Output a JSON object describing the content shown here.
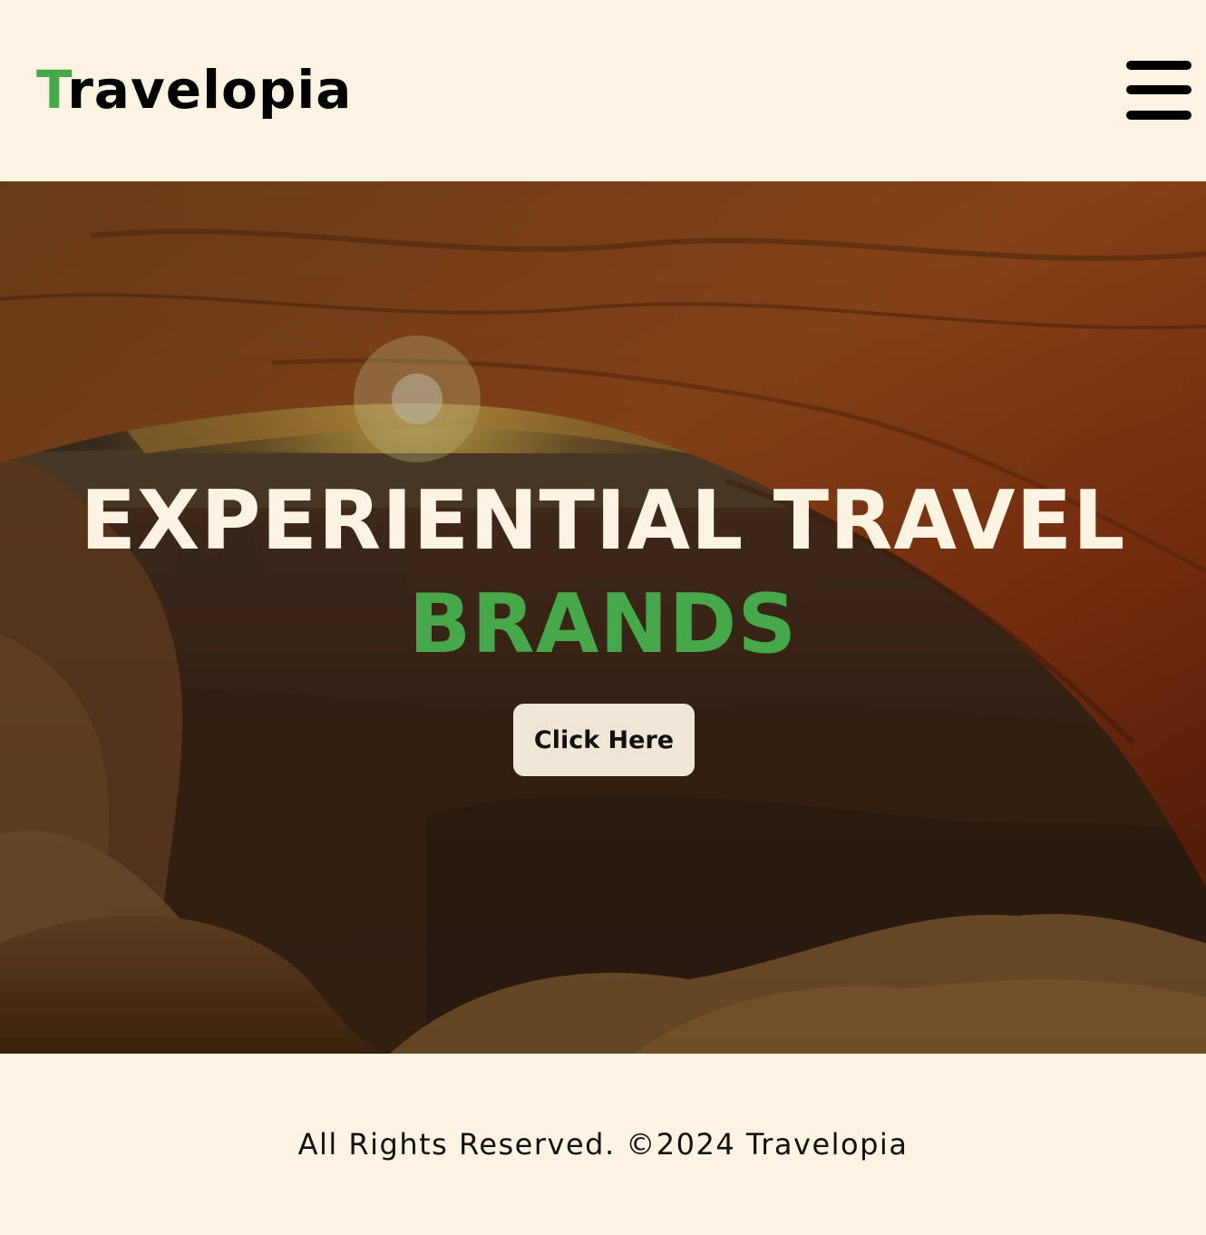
{
  "header": {
    "logo_first_letter": "T",
    "logo_rest": "ravelopia",
    "menu_icon": "hamburger-menu-icon"
  },
  "hero": {
    "title_line1": "EXPERIENTIAL TRAVEL",
    "title_line2": "BRANDS",
    "cta_label": "Click Here",
    "background_image": "desert-arch-sunrise-photo"
  },
  "footer": {
    "text": "All Rights Reserved. ©2024 Travelopia"
  },
  "colors": {
    "background": "#fdf3e2",
    "accent": "#46a84a",
    "text_dark": "#000000",
    "button_bg": "#efe6d6"
  }
}
